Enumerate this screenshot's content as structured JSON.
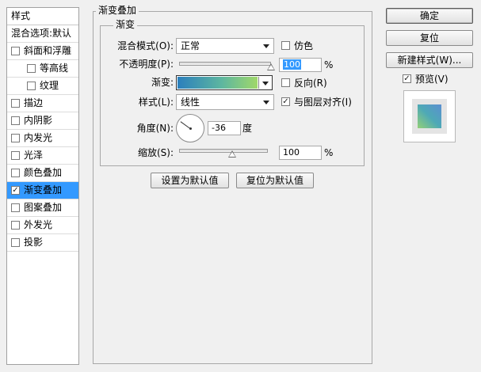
{
  "style_list": {
    "header": "样式",
    "blend_options": "混合选项:默认",
    "items": [
      {
        "label": "斜面和浮雕",
        "checked": false,
        "indent": false
      },
      {
        "label": "等高线",
        "checked": false,
        "indent": true
      },
      {
        "label": "纹理",
        "checked": false,
        "indent": true
      },
      {
        "label": "描边",
        "checked": false,
        "indent": false
      },
      {
        "label": "内阴影",
        "checked": false,
        "indent": false
      },
      {
        "label": "内发光",
        "checked": false,
        "indent": false
      },
      {
        "label": "光泽",
        "checked": false,
        "indent": false
      },
      {
        "label": "颜色叠加",
        "checked": false,
        "indent": false
      },
      {
        "label": "渐变叠加",
        "checked": true,
        "indent": false,
        "selected": true
      },
      {
        "label": "图案叠加",
        "checked": false,
        "indent": false
      },
      {
        "label": "外发光",
        "checked": false,
        "indent": false
      },
      {
        "label": "投影",
        "checked": false,
        "indent": false
      }
    ]
  },
  "panel": {
    "title": "渐变叠加",
    "section_title": "渐变",
    "blend_mode_label": "混合模式(O):",
    "blend_mode_value": "正常",
    "dither_label": "仿色",
    "dither_checked": false,
    "opacity_label": "不透明度(P):",
    "opacity_value": "100",
    "opacity_percent": 100,
    "percent_sign": "%",
    "gradient_label": "渐变:",
    "gradient_colors": [
      "#2b7fbd",
      "#5db6a0",
      "#a0d86a"
    ],
    "reverse_label": "反向(R)",
    "reverse_checked": false,
    "style_label": "样式(L):",
    "style_value": "线性",
    "align_label": "与图层对齐(I)",
    "align_checked": true,
    "angle_label": "角度(N):",
    "angle_value": "-36",
    "angle_deg": -36,
    "degree_unit": "度",
    "scale_label": "缩放(S):",
    "scale_value": "100",
    "scale_percent": 100,
    "scale_percent_sign": "%",
    "set_default_button": "设置为默认值",
    "reset_default_button": "复位为默认值"
  },
  "side": {
    "ok_button": "确定",
    "reset_button": "复位",
    "new_style_button": "新建样式(W)...",
    "preview_label": "预览(V)",
    "preview_checked": true
  },
  "icons": {
    "checkmark": "checkmark-icon",
    "dropdown": "chevron-down-icon",
    "slider_thumb": "slider-thumb-icon"
  },
  "colors": {
    "selection": "#3399ff",
    "panel_bg": "#f0f0f0"
  }
}
